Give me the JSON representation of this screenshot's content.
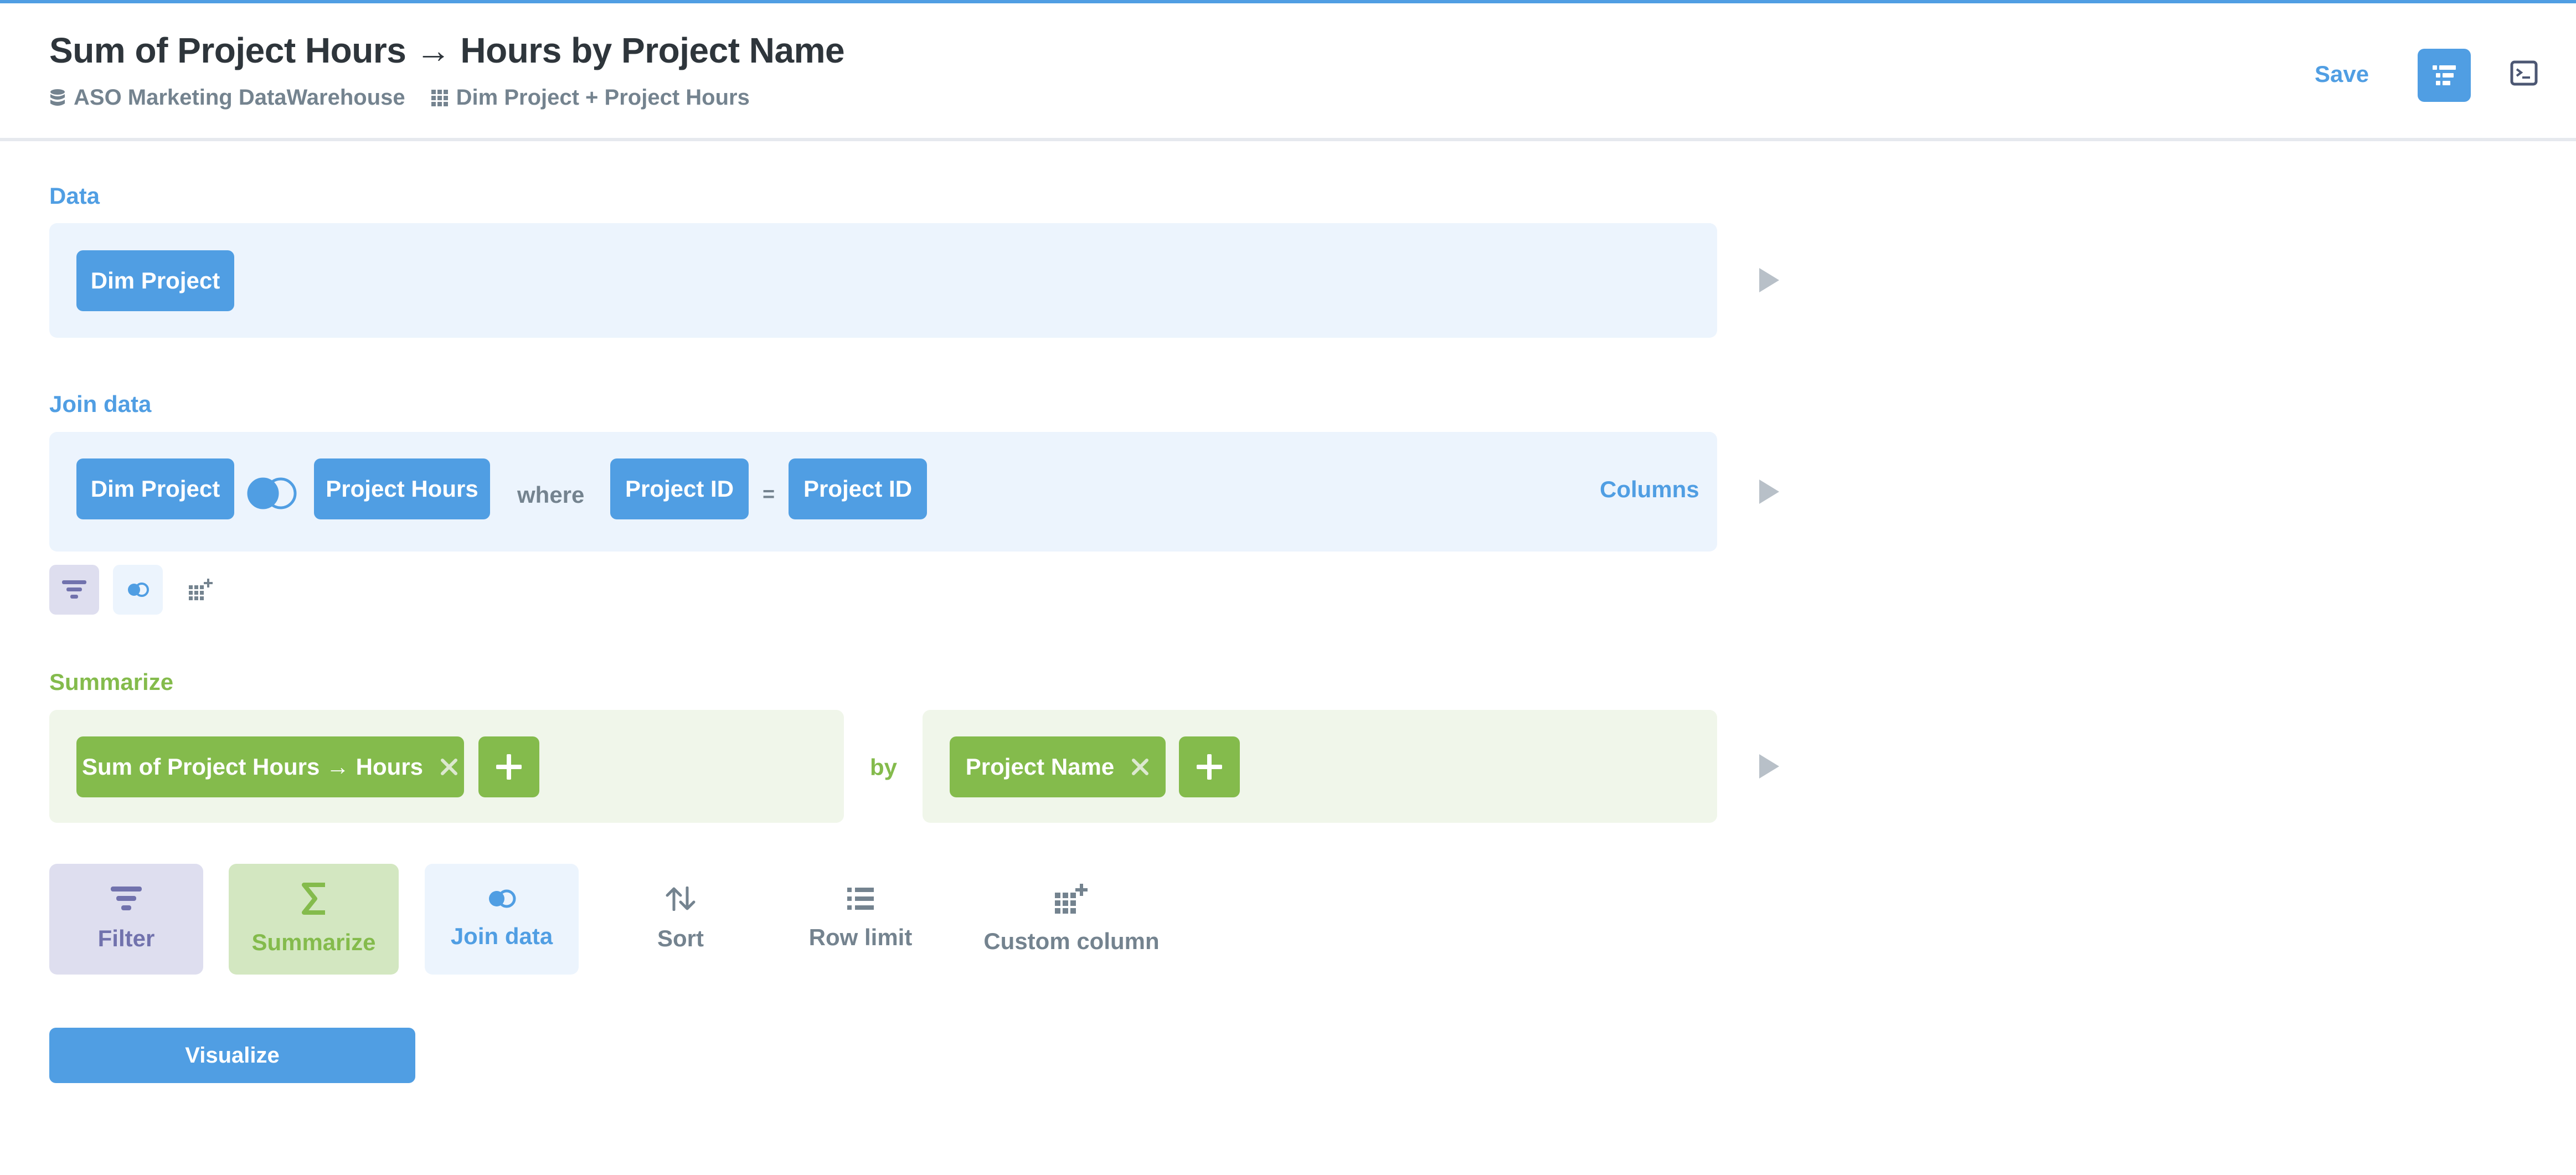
{
  "header": {
    "title": "Sum of Project Hours → Hours by Project Name",
    "database": "ASO Marketing DataWarehouse",
    "table": "Dim Project + Project Hours",
    "save_label": "Save",
    "editor_icon": "notebook-editor-icon",
    "sql_icon": "sql-console-icon"
  },
  "data_step": {
    "label": "Data",
    "table": "Dim Project"
  },
  "join_step": {
    "label": "Join data",
    "left_table": "Dim Project",
    "join_type_icon": "left-join-icon",
    "right_table": "Project Hours",
    "where": "where",
    "left_column": "Project ID",
    "operator": "=",
    "right_column": "Project ID",
    "columns_label": "Columns"
  },
  "summarize_step": {
    "label": "Summarize",
    "metric": "Sum of Project Hours → Hours",
    "by": "by",
    "breakout": "Project Name"
  },
  "actions": {
    "filter": "Filter",
    "summarize": "Summarize",
    "join": "Join data",
    "sort": "Sort",
    "row_limit": "Row limit",
    "custom_column": "Custom column"
  },
  "visualize_label": "Visualize",
  "colors": {
    "brand": "#509ee3",
    "summarize": "#84bb4c",
    "filter": "#7172ad",
    "text_dark": "#2e353b",
    "text_muted": "#74838f"
  }
}
